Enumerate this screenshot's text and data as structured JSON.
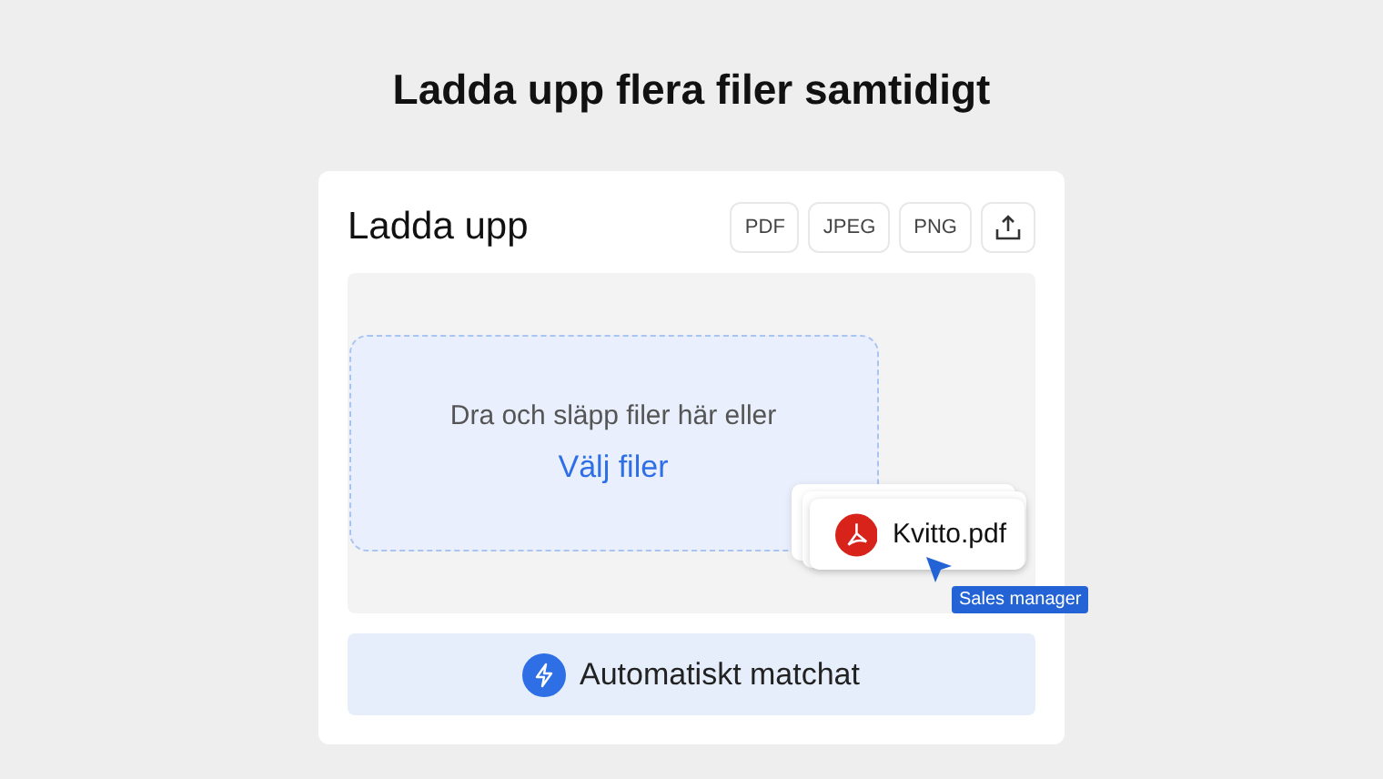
{
  "heading": "Ladda upp flera filer samtidigt",
  "card": {
    "title": "Ladda upp",
    "formats": [
      "PDF",
      "JPEG",
      "PNG"
    ]
  },
  "dropzone": {
    "prompt": "Dra och släpp filer här eller",
    "link": "Välj filer"
  },
  "dragged_file": {
    "name": "Kvitto.pdf",
    "cursor_label": "Sales manager"
  },
  "status_bar": {
    "label": "Automatiskt matchat"
  }
}
